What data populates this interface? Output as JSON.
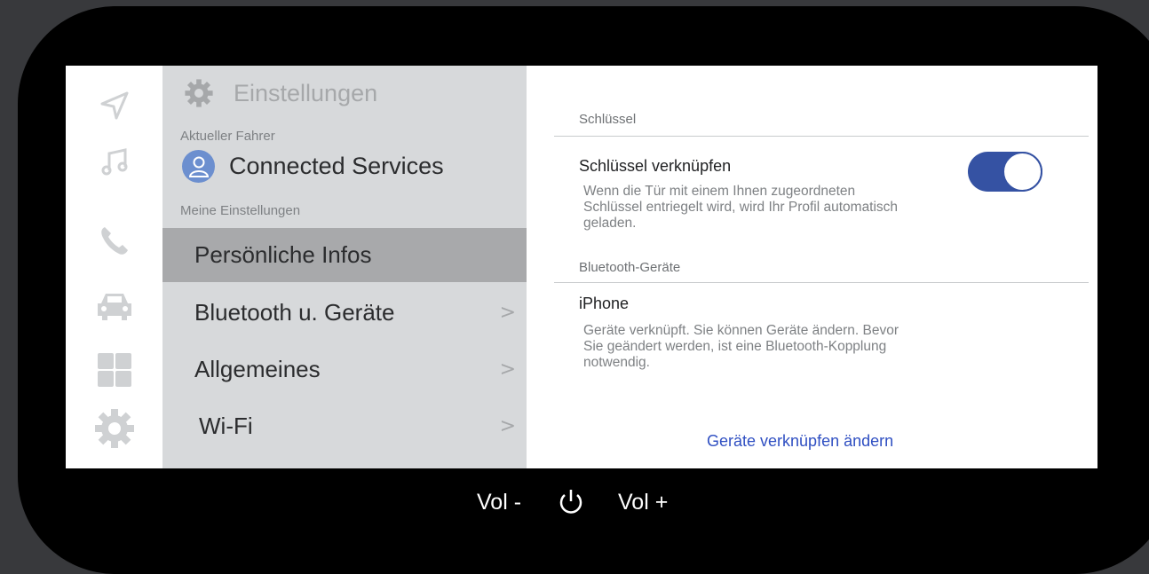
{
  "sidebar": {
    "icons": [
      "navigation-icon",
      "music-icon",
      "phone-icon",
      "car-icon",
      "apps-grid-icon",
      "settings-gear-icon"
    ]
  },
  "menu": {
    "title": "Einstellungen",
    "current_driver_label": "Aktueller Fahrer",
    "driver_name": "Connected Services",
    "my_settings_label": "Meine Einstellungen",
    "items": [
      {
        "label": "Persönliche Infos",
        "chevron": ""
      },
      {
        "label": "Bluetooth u. Geräte",
        "chevron": ">"
      },
      {
        "label": "Allgemeines",
        "chevron": ">"
      },
      {
        "label": "Wi-Fi",
        "chevron": ">"
      }
    ],
    "active_index": 0
  },
  "content": {
    "key_section": "Schlüssel",
    "key_link_title": "Schlüssel verknüpfen",
    "key_link_desc": "Wenn die Tür mit einem Ihnen zugeordneten Schlüssel entriegelt wird, wird Ihr Profil automatisch geladen.",
    "key_link_enabled": true,
    "bt_section": "Bluetooth-Geräte",
    "device_name": "iPhone",
    "device_desc": "Geräte verknüpft. Sie können Geräte ändern. Bevor Sie geändert werden, ist eine Bluetooth-Kopplung notwendig.",
    "change_link": "Geräte verknüpfen ändern"
  },
  "hardware": {
    "vol_down": "Vol -",
    "vol_up": "Vol +",
    "power_icon": "power-icon"
  },
  "colors": {
    "accent": "#3552a3",
    "link": "#2f4fc2",
    "avatar": "#6c8fcf",
    "menu_bg": "#d7d9db",
    "active_bg": "#a8a9ab"
  }
}
